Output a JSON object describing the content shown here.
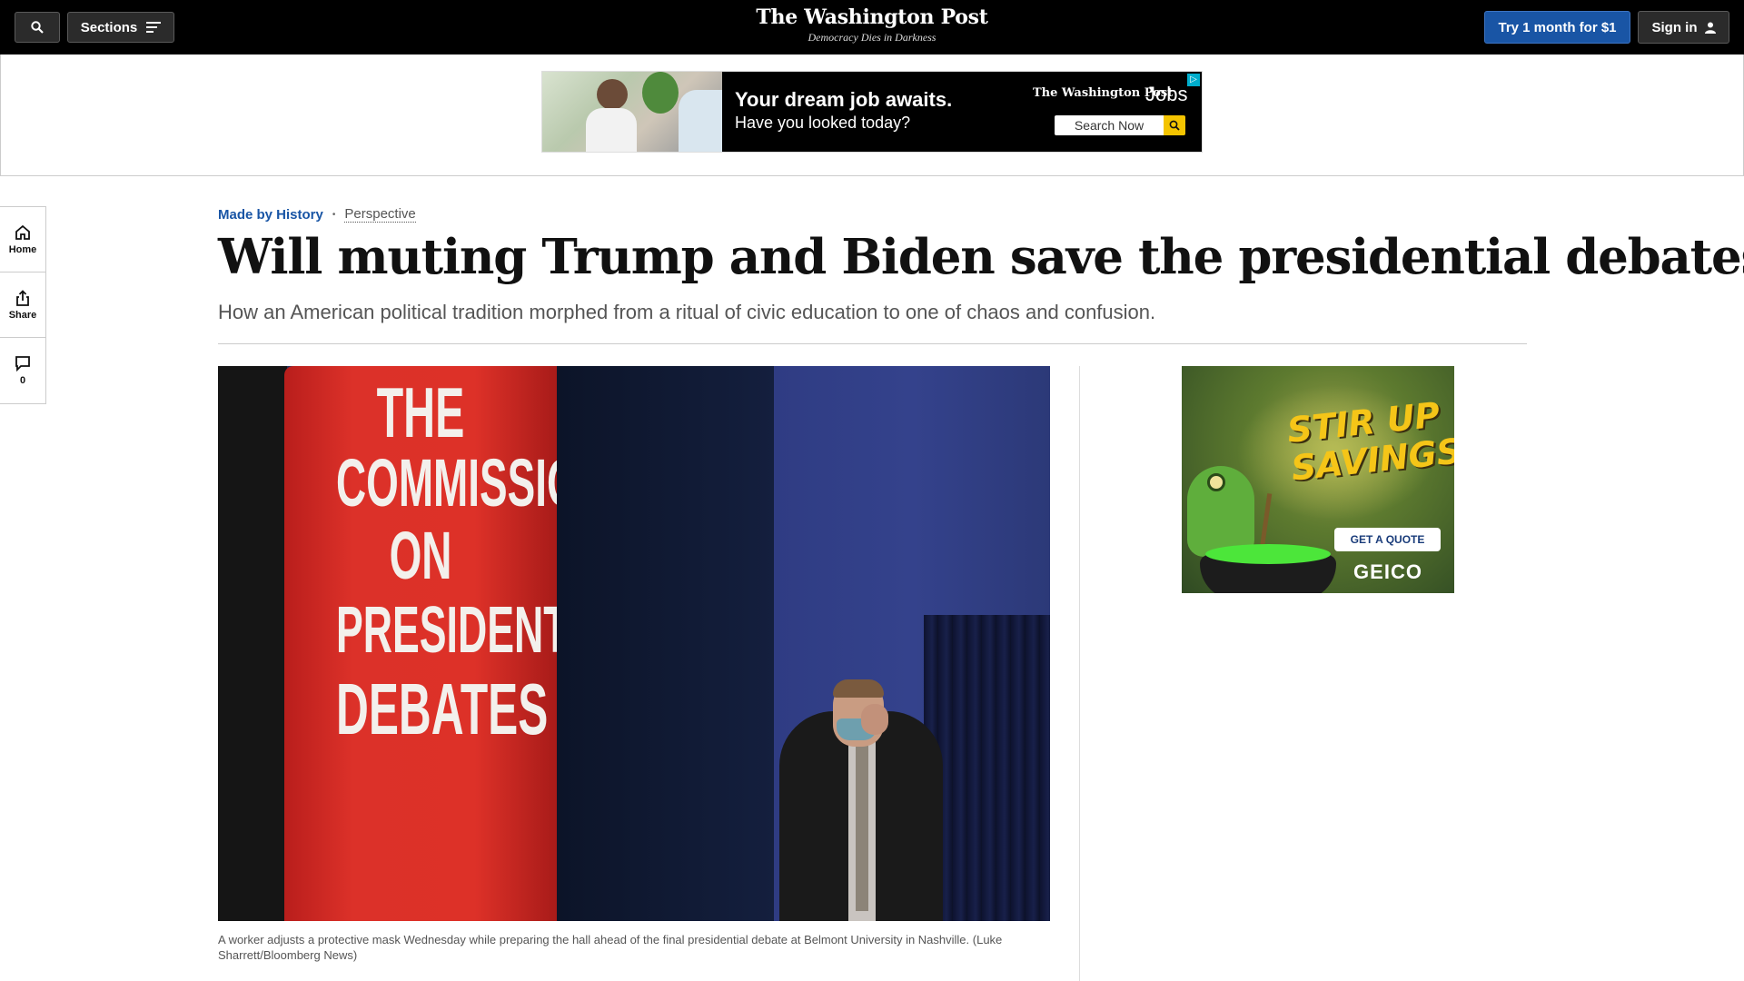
{
  "header": {
    "sections_label": "Sections",
    "logo": "The Washington Post",
    "tagline": "Democracy Dies in Darkness",
    "try_label": "Try 1 month for $1",
    "signin_label": "Sign in",
    "icons": [
      "search-icon",
      "menu-icon",
      "user-icon"
    ]
  },
  "top_ad": {
    "headline": "Your dream job awaits.",
    "subhead": "Have you looked today?",
    "brand": "The Washington Post",
    "brand_suffix": "Jobs",
    "search_label": "Search Now",
    "adchoice": "▷"
  },
  "rail": {
    "home_label": "Home",
    "share_label": "Share",
    "comments_count": "0"
  },
  "article": {
    "section": "Made by History",
    "separator": "•",
    "label": "Perspective",
    "headline": "Will muting Trump and Biden save the presidential debates?",
    "dek": "How an American political tradition morphed from a ritual of civic education to one of chaos and confusion.",
    "image_text": [
      "THE",
      "COMMISSION",
      "ON",
      "PRESIDENTIAL",
      "DEBATES"
    ],
    "caption": "A worker adjusts a protective mask Wednesday while preparing the hall ahead of the final presidential debate at Belmont University in Nashville. (Luke Sharrett/Bloomberg News)"
  },
  "side_ad": {
    "headline": "STIR UP SAVINGS",
    "cta": "GET A QUOTE",
    "logo": "GEICO"
  },
  "colors": {
    "accent_blue": "#1955a5",
    "topbar_bg": "#000000",
    "banner_red": "#dc3129"
  }
}
